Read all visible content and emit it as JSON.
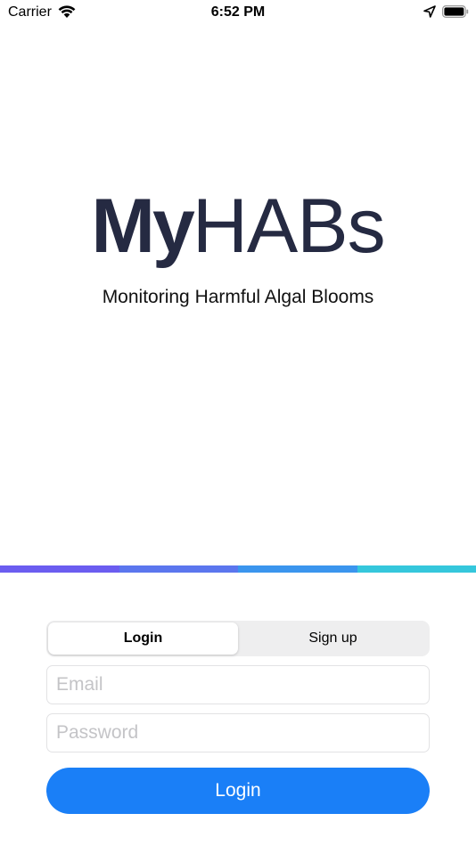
{
  "status_bar": {
    "carrier": "Carrier",
    "time": "6:52 PM",
    "icons": [
      "wifi-icon",
      "location-arrow-icon",
      "battery-icon"
    ]
  },
  "brand": {
    "logo_bold": "My",
    "logo_light": "HABs",
    "tagline": "Monitoring Harmful Algal Blooms",
    "logo_color": "#252a42",
    "strip_colors": [
      "#6b5df0",
      "#5b76ee",
      "#3b95ee",
      "#35c7dc"
    ]
  },
  "auth": {
    "tabs": [
      {
        "label": "Login",
        "active": true
      },
      {
        "label": "Sign up",
        "active": false
      }
    ],
    "email_placeholder": "Email",
    "password_placeholder": "Password",
    "submit_label": "Login",
    "accent": "#1a7ff7"
  }
}
